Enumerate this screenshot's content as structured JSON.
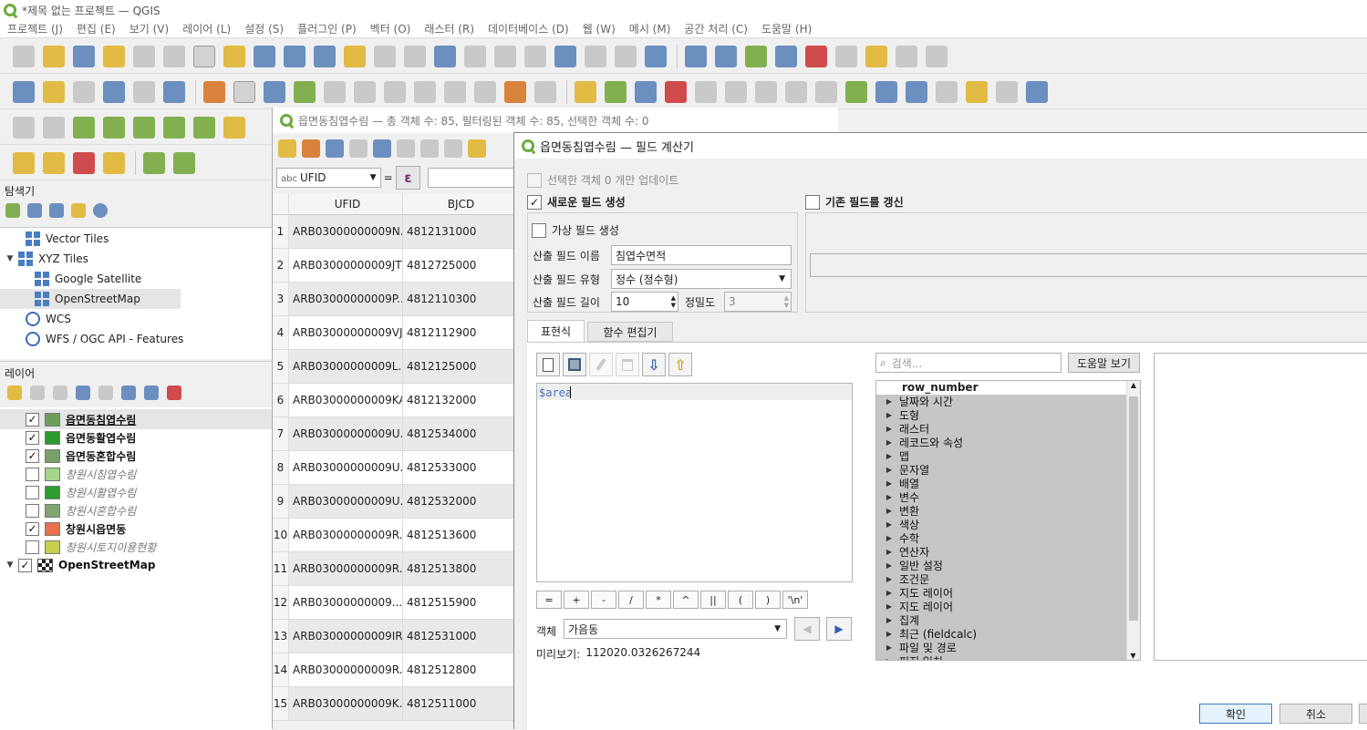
{
  "window": {
    "title": "*제목 없는 프로젝트 — QGIS"
  },
  "menu": [
    "프로젝트 (J)",
    "편집 (E)",
    "보기 (V)",
    "레이어 (L)",
    "설정 (S)",
    "플러그인 (P)",
    "벡터 (O)",
    "래스터 (R)",
    "데이터베이스 (D)",
    "웹 (W)",
    "메시 (M)",
    "공간 처리 (C)",
    "도움말 (H)"
  ],
  "browser": {
    "title": "탐색기",
    "items": [
      {
        "label": "Vector Tiles",
        "icon": "grid-icon"
      },
      {
        "label": "XYZ Tiles",
        "icon": "grid-icon"
      },
      {
        "label": "Google Satellite",
        "icon": "grid-icon"
      },
      {
        "label": "OpenStreetMap",
        "icon": "grid-icon"
      },
      {
        "label": "WCS",
        "icon": "globe-icon"
      },
      {
        "label": "WFS / OGC API - Features",
        "icon": "globe-icon"
      }
    ]
  },
  "layers": {
    "title": "레이어",
    "items": [
      {
        "label": "읍면동침엽수림",
        "color": "#6b9e5a",
        "checked": "✓"
      },
      {
        "label": "읍면동활엽수림",
        "color": "#2d9a2d",
        "checked": "✓"
      },
      {
        "label": "읍면동혼합수림",
        "color": "#7aa06a",
        "checked": "✓"
      },
      {
        "label": "창원시침엽수림",
        "color": "#a6d58a",
        "checked": ""
      },
      {
        "label": "창원시활엽수림",
        "color": "#2e9e2e",
        "checked": ""
      },
      {
        "label": "창원시혼합수림",
        "color": "#7ea572",
        "checked": ""
      },
      {
        "label": "창원시읍면동",
        "color": "#e8704a",
        "checked": "✓"
      },
      {
        "label": "창원시토지이용현황",
        "color": "#c8cf4c",
        "checked": ""
      },
      {
        "label": "OpenStreetMap",
        "color": "",
        "checked": "✓"
      }
    ]
  },
  "attr_table": {
    "title": "읍면동침엽수림 — 총 객체 수: 85, 필터링된 객체 수: 85, 선택한 객체 수: 0",
    "field_select": "UFID",
    "field_prefix": "abc",
    "columns": [
      "UFID",
      "BJCD"
    ],
    "rows": [
      {
        "n": "1",
        "ufid": "ARB03000000009N...",
        "bjcd": "4812131000"
      },
      {
        "n": "2",
        "ufid": "ARB03000000009JT0",
        "bjcd": "4812725000"
      },
      {
        "n": "3",
        "ufid": "ARB03000000009P...",
        "bjcd": "4812110300"
      },
      {
        "n": "4",
        "ufid": "ARB03000000009VJ2",
        "bjcd": "4812112900"
      },
      {
        "n": "5",
        "ufid": "ARB03000000009L...",
        "bjcd": "4812125000"
      },
      {
        "n": "6",
        "ufid": "ARB03000000009KAI",
        "bjcd": "4812132000"
      },
      {
        "n": "7",
        "ufid": "ARB03000000009U...",
        "bjcd": "4812534000"
      },
      {
        "n": "8",
        "ufid": "ARB03000000009U...",
        "bjcd": "4812533000"
      },
      {
        "n": "9",
        "ufid": "ARB03000000009U...",
        "bjcd": "4812532000"
      },
      {
        "n": "10",
        "ufid": "ARB03000000009R...",
        "bjcd": "4812513600"
      },
      {
        "n": "11",
        "ufid": "ARB03000000009R...",
        "bjcd": "4812513800"
      },
      {
        "n": "12",
        "ufid": "ARB03000000009...",
        "bjcd": "4812515900"
      },
      {
        "n": "13",
        "ufid": "ARB03000000009IRX",
        "bjcd": "4812531000"
      },
      {
        "n": "14",
        "ufid": "ARB03000000009R...",
        "bjcd": "4812512800"
      },
      {
        "n": "15",
        "ufid": "ARB03000000009K...",
        "bjcd": "4812511000"
      }
    ]
  },
  "calc": {
    "title": "읍면동침엽수림 — 필드 계산기",
    "only_selected": "선택한 객체 0 개만 업데이트",
    "create_new": "새로운 필드 생성",
    "update_existing": "기존 필드를 갱신",
    "virtual": "가상 필드 생성",
    "name_label": "산출 필드 이름",
    "name_value": "침엽수면적",
    "type_label": "산출 필드 유형",
    "type_value": "정수 (정수형)",
    "length_label": "산출 필드 길이",
    "length_value": "10",
    "precision_label": "정밀도",
    "precision_value": "3",
    "tab_expression": "표현식",
    "tab_function_editor": "함수 편집기",
    "expression": "$area",
    "operators": [
      "=",
      "+",
      "-",
      "/",
      "*",
      "^",
      "||",
      "(",
      ")",
      "'\\n'"
    ],
    "feature_label": "객체",
    "feature_value": "가음동",
    "preview_label": "미리보기:",
    "preview_value": "112020.0326267244",
    "search_placeholder": "검색...",
    "help_button": "도움말 보기",
    "top_item": "row_number",
    "categories": [
      "날짜와 시간",
      "도형",
      "래스터",
      "레코드와 속성",
      "맵",
      "문자열",
      "배열",
      "변수",
      "변환",
      "색상",
      "수학",
      "연산자",
      "일반 설정",
      "조건문",
      "지도 레이어",
      "지도 레이어",
      "집계",
      "최근 (fieldcalc)",
      "파일 및 경로",
      "퍼지 일치"
    ],
    "ok": "확인",
    "cancel": "취소"
  }
}
